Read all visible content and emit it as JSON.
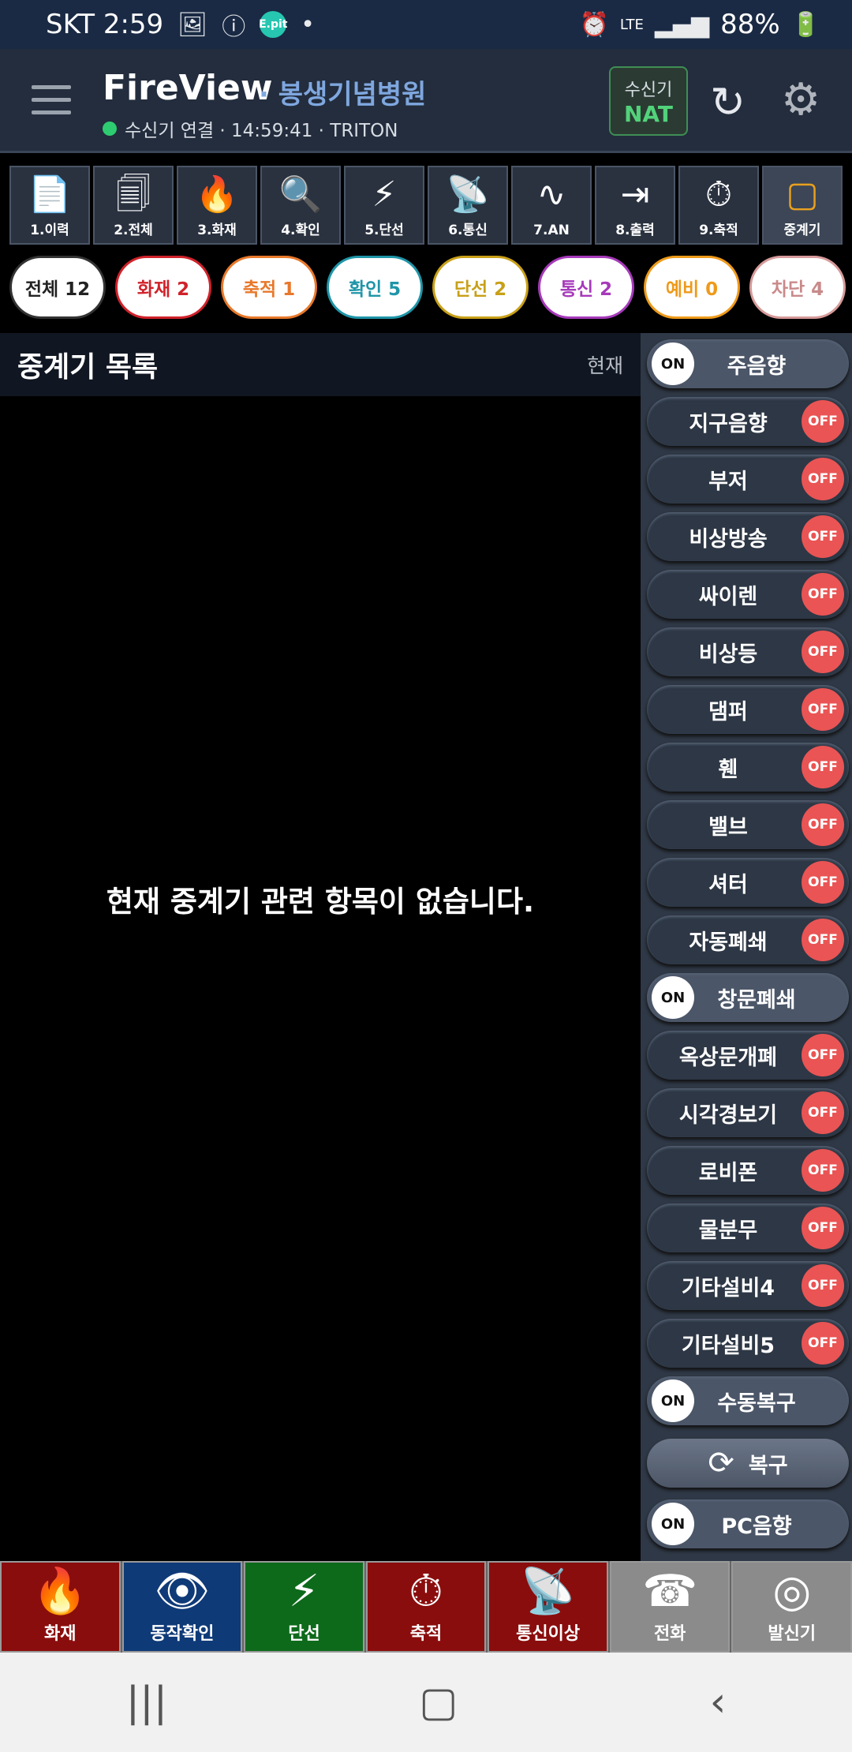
{
  "status_bar": {
    "carrier_time": "SKT 2:59",
    "network": "LTE",
    "battery": "88%"
  },
  "header": {
    "brand": "FireView",
    "hospital": "· 봉생기념병원",
    "connection": "수신기 연결 · 14:59:41 · TRITON",
    "receiver_label": "수신기",
    "receiver_value": "NAT"
  },
  "tools": [
    {
      "label": "1.이력",
      "icon": "📄"
    },
    {
      "label": "2.전체",
      "icon": "🗐"
    },
    {
      "label": "3.화재",
      "icon": "🔥"
    },
    {
      "label": "4.확인",
      "icon": "🔍"
    },
    {
      "label": "5.단선",
      "icon": "⚡"
    },
    {
      "label": "6.통신",
      "icon": "📡"
    },
    {
      "label": "7.AN",
      "icon": "∿"
    },
    {
      "label": "8.출력",
      "icon": "⇥"
    },
    {
      "label": "9.축적",
      "icon": "⏱"
    },
    {
      "label": "중계기",
      "icon": "▢"
    }
  ],
  "filters": [
    {
      "label": "전체 12",
      "color": "#333333"
    },
    {
      "label": "화재 2",
      "color": "#d0222a"
    },
    {
      "label": "축적 1",
      "color": "#e8782a"
    },
    {
      "label": "확인 5",
      "color": "#1f95a8"
    },
    {
      "label": "단선 2",
      "color": "#c8a018"
    },
    {
      "label": "통신 2",
      "color": "#a63aba"
    },
    {
      "label": "예비 0",
      "color": "#ee9a1a"
    },
    {
      "label": "차단 4",
      "color": "#d79a9a"
    }
  ],
  "main": {
    "title": "중계기 목록",
    "current": "현재",
    "empty_message": "현재 중계기 관련 항목이 없습니다."
  },
  "switches": [
    {
      "label": "주음향",
      "state": "ON"
    },
    {
      "label": "지구음향",
      "state": "OFF"
    },
    {
      "label": "부저",
      "state": "OFF"
    },
    {
      "label": "비상방송",
      "state": "OFF"
    },
    {
      "label": "싸이렌",
      "state": "OFF"
    },
    {
      "label": "비상등",
      "state": "OFF"
    },
    {
      "label": "댐퍼",
      "state": "OFF"
    },
    {
      "label": "휀",
      "state": "OFF"
    },
    {
      "label": "밸브",
      "state": "OFF"
    },
    {
      "label": "셔터",
      "state": "OFF"
    },
    {
      "label": "자동폐쇄",
      "state": "OFF"
    },
    {
      "label": "창문폐쇄",
      "state": "ON"
    },
    {
      "label": "옥상문개폐",
      "state": "OFF"
    },
    {
      "label": "시각경보기",
      "state": "OFF"
    },
    {
      "label": "로비폰",
      "state": "OFF"
    },
    {
      "label": "물분무",
      "state": "OFF"
    },
    {
      "label": "기타설비4",
      "state": "OFF"
    },
    {
      "label": "기타설비5",
      "state": "OFF"
    },
    {
      "label": "수동복구",
      "state": "ON"
    }
  ],
  "restore_label": "복구",
  "pc_sound": {
    "label": "PC음향",
    "state": "ON"
  },
  "actions": [
    {
      "label": "화재",
      "icon": "🔥",
      "bg": "#8a0d0d"
    },
    {
      "label": "동작확인",
      "icon": "👁",
      "bg": "#0f3a78"
    },
    {
      "label": "단선",
      "icon": "⚡",
      "bg": "#0d6a1b"
    },
    {
      "label": "축적",
      "icon": "⏱",
      "bg": "#8a0d0d"
    },
    {
      "label": "통신이상",
      "icon": "📡",
      "bg": "#8a0d0d"
    },
    {
      "label": "전화",
      "icon": "☎",
      "bg": "#8b8b8b"
    },
    {
      "label": "발신기",
      "icon": "◎",
      "bg": "#8b8b8b"
    }
  ]
}
